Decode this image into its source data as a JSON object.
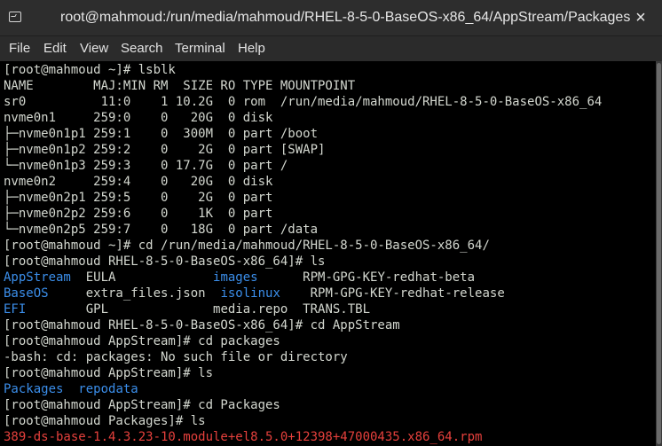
{
  "window": {
    "title": "root@mahmoud:/run/media/mahmoud/RHEL-8-5-0-BaseOS-x86_64/AppStream/Packages",
    "close_glyph": "×"
  },
  "menu": [
    "File",
    "Edit",
    "View",
    "Search",
    "Terminal",
    "Help"
  ],
  "terminal": {
    "lines": [
      [
        {
          "t": "[root@mahmoud ~]# lsblk"
        }
      ],
      [
        {
          "t": "NAME        MAJ:MIN RM  SIZE RO TYPE MOUNTPOINT"
        }
      ],
      [
        {
          "t": "sr0          11:0    1 10.2G  0 rom  /run/media/mahmoud/RHEL-8-5-0-BaseOS-x86_64"
        }
      ],
      [
        {
          "t": "nvme0n1     259:0    0   20G  0 disk"
        }
      ],
      [
        {
          "t": "├─nvme0n1p1 259:1    0  300M  0 part /boot"
        }
      ],
      [
        {
          "t": "├─nvme0n1p2 259:2    0    2G  0 part [SWAP]"
        }
      ],
      [
        {
          "t": "└─nvme0n1p3 259:3    0 17.7G  0 part /"
        }
      ],
      [
        {
          "t": "nvme0n2     259:4    0   20G  0 disk"
        }
      ],
      [
        {
          "t": "├─nvme0n2p1 259:5    0    2G  0 part"
        }
      ],
      [
        {
          "t": "├─nvme0n2p2 259:6    0    1K  0 part"
        }
      ],
      [
        {
          "t": "└─nvme0n2p5 259:7    0   18G  0 part /data"
        }
      ],
      [
        {
          "t": "[root@mahmoud ~]# cd /run/media/mahmoud/RHEL-8-5-0-BaseOS-x86_64/"
        }
      ],
      [
        {
          "t": "[root@mahmoud RHEL-8-5-0-BaseOS-x86_64]# ls"
        }
      ],
      [
        {
          "t": "AppStream",
          "c": "blue"
        },
        {
          "t": "  EULA             "
        },
        {
          "t": "images",
          "c": "blue"
        },
        {
          "t": "      RPM-GPG-KEY-redhat-beta"
        }
      ],
      [
        {
          "t": "BaseOS",
          "c": "blue"
        },
        {
          "t": "     extra_files.json  "
        },
        {
          "t": "isolinux",
          "c": "blue"
        },
        {
          "t": "    RPM-GPG-KEY-redhat-release"
        }
      ],
      [
        {
          "t": "EFI",
          "c": "blue"
        },
        {
          "t": "        GPL              media.repo  TRANS.TBL"
        }
      ],
      [
        {
          "t": "[root@mahmoud RHEL-8-5-0-BaseOS-x86_64]# cd AppStream"
        }
      ],
      [
        {
          "t": "[root@mahmoud AppStream]# cd packages"
        }
      ],
      [
        {
          "t": "-bash: cd: packages: No such file or directory"
        }
      ],
      [
        {
          "t": "[root@mahmoud AppStream]# ls"
        }
      ],
      [
        {
          "t": "Packages",
          "c": "blue"
        },
        {
          "t": "  "
        },
        {
          "t": "repodata",
          "c": "blue"
        }
      ],
      [
        {
          "t": "[root@mahmoud AppStream]# cd Packages"
        }
      ],
      [
        {
          "t": "[root@mahmoud Packages]# ls"
        }
      ],
      [
        {
          "t": "389-ds-base-1.4.3.23-10.module+el8.5.0+12398+47000435.x86_64.rpm",
          "c": "red"
        }
      ]
    ]
  },
  "colors": {
    "titlebar": "#2d2d2d",
    "terminal_bg": "#000000",
    "terminal_fg": "#d3d7cf",
    "directory": "#3b8eea",
    "package_file": "#e5403c"
  },
  "icons": {
    "title": "terminal-app-icon",
    "close": "close-icon"
  }
}
